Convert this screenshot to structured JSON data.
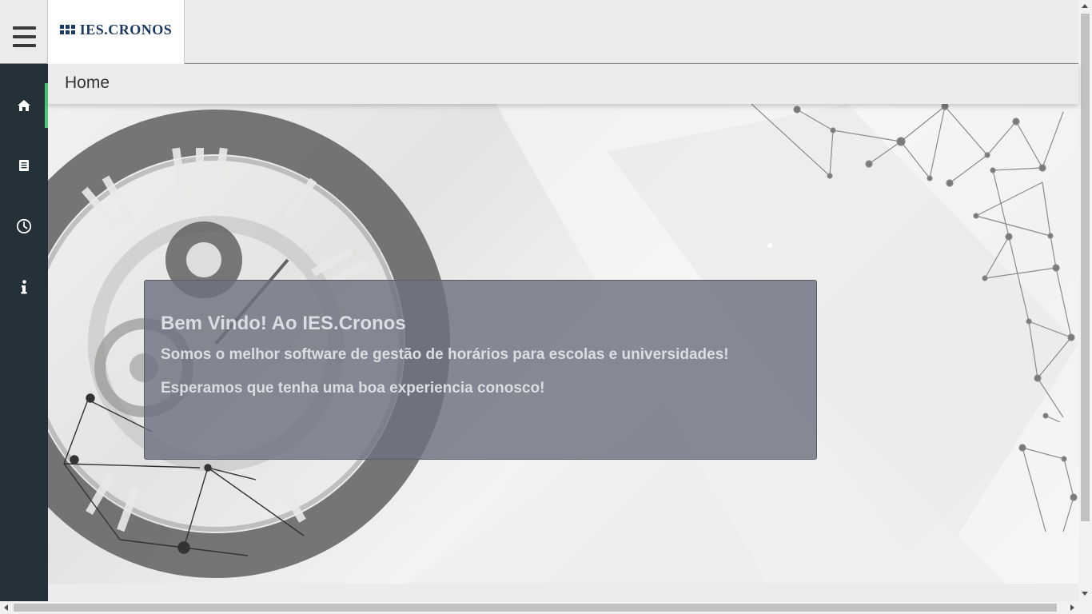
{
  "app": {
    "logo_text": "IES.CRONOS"
  },
  "sidebar": {
    "items": [
      {
        "icon": "home-icon",
        "active": true
      },
      {
        "icon": "document-icon",
        "active": false
      },
      {
        "icon": "clock-icon",
        "active": false
      },
      {
        "icon": "info-icon",
        "active": false
      }
    ]
  },
  "breadcrumb": {
    "title": "Home"
  },
  "welcome": {
    "heading": "Bem Vindo! Ao IES.Cronos",
    "line1": "Somos o melhor software de gestão de horários para escolas e universidades!",
    "line2": "Esperamos que tenha uma boa experiencia conosco!"
  },
  "colors": {
    "sidebar_bg": "#243138",
    "active_indicator": "#4cc97a",
    "logo_blue": "#1f3a62",
    "card_bg": "#6e7180"
  }
}
